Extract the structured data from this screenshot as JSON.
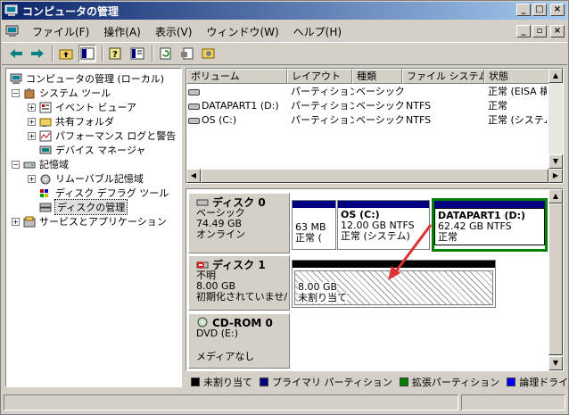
{
  "window": {
    "title": "コンピュータの管理"
  },
  "menu": [
    "ファイル(F)",
    "操作(A)",
    "表示(V)",
    "ウィンドウ(W)",
    "ヘルプ(H)"
  ],
  "toolbar": {
    "icons": [
      "back-arrow-icon",
      "forward-arrow-icon",
      "up-folder-icon",
      "show-tree-icon",
      "help-icon",
      "properties-icon",
      "refresh-icon",
      "export-icon",
      "settings-icon"
    ]
  },
  "tree": {
    "root": "コンピュータの管理 (ローカル)",
    "system_tools": "システム ツール",
    "event_viewer": "イベント ビューア",
    "shared_folders": "共有フォルダ",
    "perf_logs": "パフォーマンス ログと警告",
    "device_manager": "デバイス マネージャ",
    "storage": "記憶域",
    "removable": "リムーバブル記憶域",
    "defrag": "ディスク デフラグ ツール",
    "disk_mgmt": "ディスクの管理",
    "services": "サービスとアプリケーション"
  },
  "volumes": {
    "headers": [
      "ボリューム",
      "レイアウト",
      "種類",
      "ファイル システム",
      "状態"
    ],
    "rows": [
      [
        "",
        "パーティション",
        "ベーシック",
        "",
        "正常 (EISA 構成"
      ],
      [
        "DATAPART1 (D:)",
        "パーティション",
        "ベーシック",
        "NTFS",
        "正常"
      ],
      [
        "OS (C:)",
        "パーティション",
        "ベーシック",
        "NTFS",
        "正常 (システム)"
      ]
    ]
  },
  "disks": {
    "disk0": {
      "name": "ディスク 0",
      "type": "ベーシック",
      "size": "74.49 GB",
      "status": "オンライン",
      "p1_size": "63 MB",
      "p1_status": "正常 (",
      "p2_name": "OS  (C:)",
      "p2_size": "12.00 GB NTFS",
      "p2_status": "正常 (システム)",
      "p3_name": "DATAPART1  (D:)",
      "p3_size": "62.42 GB NTFS",
      "p3_status": "正常"
    },
    "disk1": {
      "name": "ディスク 1",
      "type": "不明",
      "size": "8.00 GB",
      "status": "初期化されていませ/",
      "p_size": "8.00 GB",
      "p_status": "未割り当て"
    },
    "cdrom0": {
      "name": "CD-ROM 0",
      "type": "DVD (E:)",
      "status": "メディアなし"
    }
  },
  "legend": [
    {
      "label": "未割り当て",
      "color": "#000000"
    },
    {
      "label": "プライマリ パーティション",
      "color": "#000080"
    },
    {
      "label": "拡張パーティション",
      "color": "#008000"
    },
    {
      "label": "論理ドライブ",
      "color": "#0000ff"
    }
  ],
  "colors": {
    "title_start": "#0a246a",
    "title_end": "#a6caf0",
    "primary": "#000080",
    "extended": "#008000",
    "logical": "#0000ff",
    "arrow": "#e03030"
  }
}
